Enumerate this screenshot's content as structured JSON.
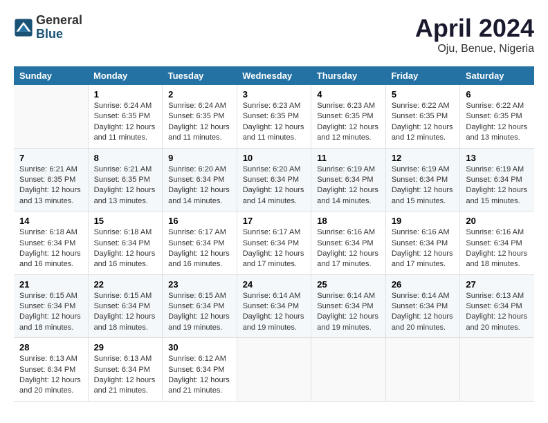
{
  "header": {
    "logo_general": "General",
    "logo_blue": "Blue",
    "title": "April 2024",
    "subtitle": "Oju, Benue, Nigeria"
  },
  "calendar": {
    "weekdays": [
      "Sunday",
      "Monday",
      "Tuesday",
      "Wednesday",
      "Thursday",
      "Friday",
      "Saturday"
    ],
    "weeks": [
      [
        {
          "day": "",
          "info": ""
        },
        {
          "day": "1",
          "info": "Sunrise: 6:24 AM\nSunset: 6:35 PM\nDaylight: 12 hours\nand 11 minutes."
        },
        {
          "day": "2",
          "info": "Sunrise: 6:24 AM\nSunset: 6:35 PM\nDaylight: 12 hours\nand 11 minutes."
        },
        {
          "day": "3",
          "info": "Sunrise: 6:23 AM\nSunset: 6:35 PM\nDaylight: 12 hours\nand 11 minutes."
        },
        {
          "day": "4",
          "info": "Sunrise: 6:23 AM\nSunset: 6:35 PM\nDaylight: 12 hours\nand 12 minutes."
        },
        {
          "day": "5",
          "info": "Sunrise: 6:22 AM\nSunset: 6:35 PM\nDaylight: 12 hours\nand 12 minutes."
        },
        {
          "day": "6",
          "info": "Sunrise: 6:22 AM\nSunset: 6:35 PM\nDaylight: 12 hours\nand 13 minutes."
        }
      ],
      [
        {
          "day": "7",
          "info": "Sunrise: 6:21 AM\nSunset: 6:35 PM\nDaylight: 12 hours\nand 13 minutes."
        },
        {
          "day": "8",
          "info": "Sunrise: 6:21 AM\nSunset: 6:35 PM\nDaylight: 12 hours\nand 13 minutes."
        },
        {
          "day": "9",
          "info": "Sunrise: 6:20 AM\nSunset: 6:34 PM\nDaylight: 12 hours\nand 14 minutes."
        },
        {
          "day": "10",
          "info": "Sunrise: 6:20 AM\nSunset: 6:34 PM\nDaylight: 12 hours\nand 14 minutes."
        },
        {
          "day": "11",
          "info": "Sunrise: 6:19 AM\nSunset: 6:34 PM\nDaylight: 12 hours\nand 14 minutes."
        },
        {
          "day": "12",
          "info": "Sunrise: 6:19 AM\nSunset: 6:34 PM\nDaylight: 12 hours\nand 15 minutes."
        },
        {
          "day": "13",
          "info": "Sunrise: 6:19 AM\nSunset: 6:34 PM\nDaylight: 12 hours\nand 15 minutes."
        }
      ],
      [
        {
          "day": "14",
          "info": "Sunrise: 6:18 AM\nSunset: 6:34 PM\nDaylight: 12 hours\nand 16 minutes."
        },
        {
          "day": "15",
          "info": "Sunrise: 6:18 AM\nSunset: 6:34 PM\nDaylight: 12 hours\nand 16 minutes."
        },
        {
          "day": "16",
          "info": "Sunrise: 6:17 AM\nSunset: 6:34 PM\nDaylight: 12 hours\nand 16 minutes."
        },
        {
          "day": "17",
          "info": "Sunrise: 6:17 AM\nSunset: 6:34 PM\nDaylight: 12 hours\nand 17 minutes."
        },
        {
          "day": "18",
          "info": "Sunrise: 6:16 AM\nSunset: 6:34 PM\nDaylight: 12 hours\nand 17 minutes."
        },
        {
          "day": "19",
          "info": "Sunrise: 6:16 AM\nSunset: 6:34 PM\nDaylight: 12 hours\nand 17 minutes."
        },
        {
          "day": "20",
          "info": "Sunrise: 6:16 AM\nSunset: 6:34 PM\nDaylight: 12 hours\nand 18 minutes."
        }
      ],
      [
        {
          "day": "21",
          "info": "Sunrise: 6:15 AM\nSunset: 6:34 PM\nDaylight: 12 hours\nand 18 minutes."
        },
        {
          "day": "22",
          "info": "Sunrise: 6:15 AM\nSunset: 6:34 PM\nDaylight: 12 hours\nand 18 minutes."
        },
        {
          "day": "23",
          "info": "Sunrise: 6:15 AM\nSunset: 6:34 PM\nDaylight: 12 hours\nand 19 minutes."
        },
        {
          "day": "24",
          "info": "Sunrise: 6:14 AM\nSunset: 6:34 PM\nDaylight: 12 hours\nand 19 minutes."
        },
        {
          "day": "25",
          "info": "Sunrise: 6:14 AM\nSunset: 6:34 PM\nDaylight: 12 hours\nand 19 minutes."
        },
        {
          "day": "26",
          "info": "Sunrise: 6:14 AM\nSunset: 6:34 PM\nDaylight: 12 hours\nand 20 minutes."
        },
        {
          "day": "27",
          "info": "Sunrise: 6:13 AM\nSunset: 6:34 PM\nDaylight: 12 hours\nand 20 minutes."
        }
      ],
      [
        {
          "day": "28",
          "info": "Sunrise: 6:13 AM\nSunset: 6:34 PM\nDaylight: 12 hours\nand 20 minutes."
        },
        {
          "day": "29",
          "info": "Sunrise: 6:13 AM\nSunset: 6:34 PM\nDaylight: 12 hours\nand 21 minutes."
        },
        {
          "day": "30",
          "info": "Sunrise: 6:12 AM\nSunset: 6:34 PM\nDaylight: 12 hours\nand 21 minutes."
        },
        {
          "day": "",
          "info": ""
        },
        {
          "day": "",
          "info": ""
        },
        {
          "day": "",
          "info": ""
        },
        {
          "day": "",
          "info": ""
        }
      ]
    ]
  }
}
